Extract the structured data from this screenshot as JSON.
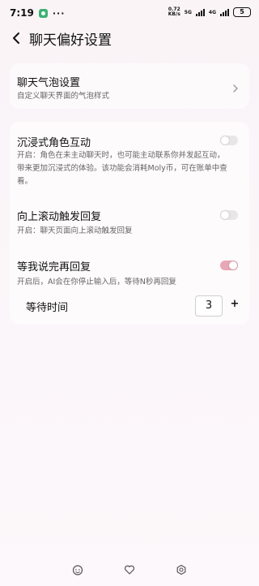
{
  "status_bar": {
    "time": "7:19",
    "more": "···",
    "net_speed_value": "0.72",
    "net_speed_unit": "KB/s",
    "sig1": "5G",
    "sig2": "4G",
    "battery": "5"
  },
  "header": {
    "title": "聊天偏好设置"
  },
  "bubble_settings": {
    "title": "聊天气泡设置",
    "desc": "自定义聊天界面的气泡样式"
  },
  "immersive": {
    "title": "沉浸式角色互动",
    "desc_lines": [
      "开启：角色在未主动聊天时，也可能主动联系你并发起互动，",
      "带来更加沉浸式的体验。该功能会消耗Moly币，可在账单中查",
      "看。"
    ],
    "enabled": false
  },
  "scroll_reply": {
    "title": "向上滚动触发回复",
    "desc": "开启：聊天页面向上滚动触发回复",
    "enabled": false
  },
  "wait_reply": {
    "title": "等我说完再回复",
    "desc": "开启后，AI会在你停止输入后，等待N秒再回复",
    "enabled": true,
    "wait_label": "等待时间",
    "minus": "-",
    "plus": "+",
    "wait_value": "3"
  },
  "colors": {
    "accent": "#e9a7b6",
    "background": "#faf4f7"
  },
  "bottom_nav": {
    "icons": [
      "face-icon",
      "heart-icon",
      "gear-icon"
    ]
  }
}
